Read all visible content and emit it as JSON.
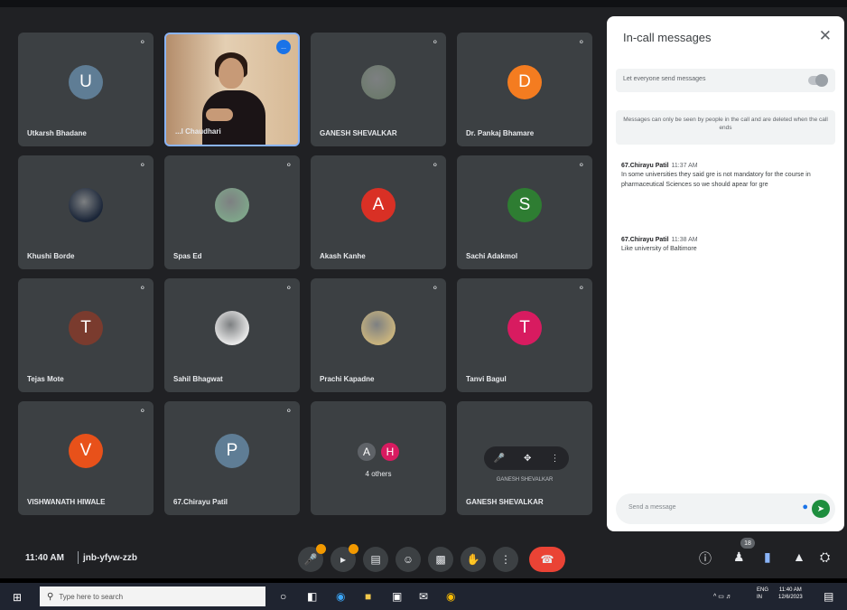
{
  "participants": [
    {
      "name": "Utkarsh Bhadane",
      "type": "initial",
      "initial": "U",
      "color": "#5f7d95"
    },
    {
      "name": "...l Chaudhari",
      "type": "video",
      "badge": "..."
    },
    {
      "name": "GANESH SHEVALKAR",
      "type": "photo",
      "color": "#6d7a6d"
    },
    {
      "name": "Dr. Pankaj Bhamare",
      "type": "initial",
      "initial": "D",
      "color": "#f47c20"
    },
    {
      "name": "Khushi Borde",
      "type": "photo",
      "color": "#1a2538"
    },
    {
      "name": "Spas Ed",
      "type": "photo",
      "color": "#7fa58a"
    },
    {
      "name": "Akash Kanhe",
      "type": "initial",
      "initial": "A",
      "color": "#d93025"
    },
    {
      "name": "Sachi Adakmol",
      "type": "initial",
      "initial": "S",
      "color": "#2e7d32"
    },
    {
      "name": "Tejas Mote",
      "type": "initial",
      "initial": "T",
      "color": "#7a3b2e"
    },
    {
      "name": "Sahil Bhagwat",
      "type": "photo",
      "color": "#e8e8e8"
    },
    {
      "name": "Prachi Kapadne",
      "type": "photo",
      "color": "#c9b47e"
    },
    {
      "name": "Tanvi Bagul",
      "type": "initial",
      "initial": "T",
      "color": "#d81b60"
    },
    {
      "name": "VISHWANATH HIWALE",
      "type": "initial",
      "initial": "V",
      "color": "#e8511a"
    },
    {
      "name": "67.Chirayu Patil",
      "type": "initial",
      "initial": "P",
      "color": "#5f7d95"
    },
    {
      "name": "",
      "type": "others",
      "others_label": "4 others",
      "initials": [
        "A",
        "H"
      ],
      "colors": [
        "#5f6368",
        "#d81b60"
      ]
    },
    {
      "name": "GANESH SHEVALKAR",
      "type": "pip",
      "pip_label": "GANESH SHEVALKAR"
    }
  ],
  "chat": {
    "title": "In-call messages",
    "close_icon": "✕",
    "toggle_label": "Let everyone send messages",
    "info": "Messages can only be seen by people in the call and are deleted when the call ends",
    "messages": [
      {
        "sender": "67.Chirayu Patil",
        "time": "11:37 AM",
        "text": "In some universities they said gre is not mandatory for the course in pharmaceutical Sciences so we should apear for gre"
      },
      {
        "sender": "67.Chirayu Patil",
        "time": "11:38 AM",
        "text": "Like university of Baltimore"
      }
    ],
    "input_placeholder": "Send a message"
  },
  "meeting": {
    "time": "11:40 AM",
    "code": "jnb-yfyw-zzb",
    "participant_count": "18"
  },
  "taskbar": {
    "search_placeholder": "Type here to search",
    "lang": "ENG",
    "region": "IN",
    "time": "11:40 AM",
    "date": "12/6/2023"
  },
  "accent": "#1a73e8",
  "end_call_color": "#ea4335"
}
